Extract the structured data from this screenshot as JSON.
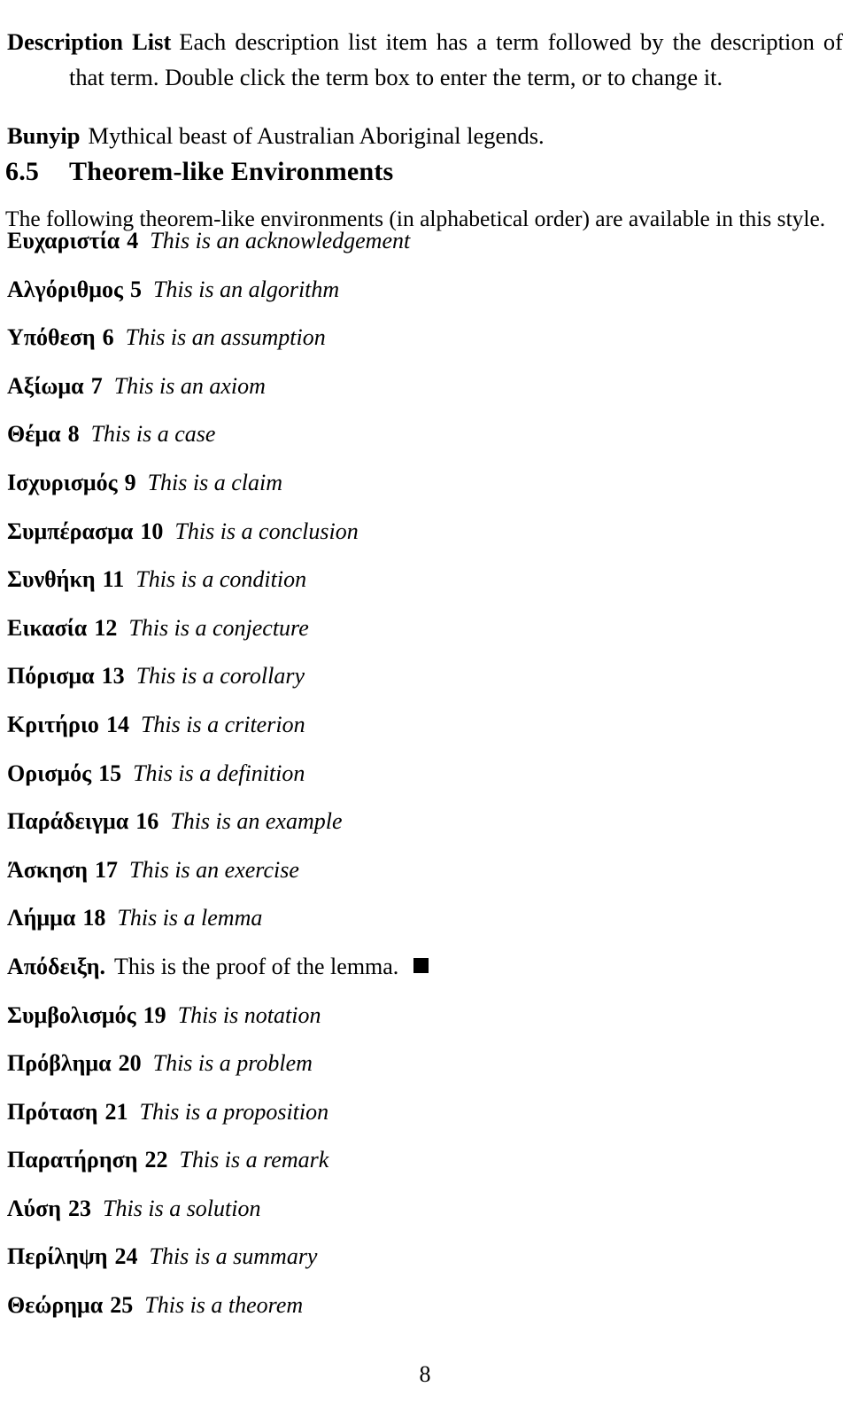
{
  "document": {
    "page_number": "8"
  },
  "description_list": [
    {
      "term": "Description List",
      "body": "Each description list item has a term followed by the description of that term.  Double click the term box to enter the term, or to change it."
    },
    {
      "term": "Bunyip",
      "body": "Mythical beast of Australian Aboriginal legends."
    }
  ],
  "section": {
    "number": "6.5",
    "title": "Theorem-like Environments",
    "intro": "The following theorem-like environments (in alphabetical order) are available in this style."
  },
  "theorems": [
    {
      "head": "Ευχαριστία",
      "num": "4",
      "body": "This is an acknowledgement"
    },
    {
      "head": "Αλγόριθμος",
      "num": "5",
      "body": "This is an algorithm"
    },
    {
      "head": "Υπόθεση",
      "num": "6",
      "body": "This is an assumption"
    },
    {
      "head": "Αξίωμα",
      "num": "7",
      "body": "This is an axiom"
    },
    {
      "head": "Θέμα",
      "num": "8",
      "body": "This is a case"
    },
    {
      "head": "Ισχυρισμός",
      "num": "9",
      "body": "This is a claim"
    },
    {
      "head": "Συμπέρασμα",
      "num": "10",
      "body": "This is a conclusion"
    },
    {
      "head": "Συνθήκη",
      "num": "11",
      "body": "This is a condition"
    },
    {
      "head": "Εικασία",
      "num": "12",
      "body": "This is a conjecture"
    },
    {
      "head": "Πόρισμα",
      "num": "13",
      "body": "This is a corollary"
    },
    {
      "head": "Κριτήριο",
      "num": "14",
      "body": "This is a criterion"
    },
    {
      "head": "Ορισμός",
      "num": "15",
      "body": "This is a definition"
    },
    {
      "head": "Παράδειγμα",
      "num": "16",
      "body": "This is an example"
    },
    {
      "head": "Άσκηση",
      "num": "17",
      "body": "This is an exercise"
    },
    {
      "head": "Λήμμα",
      "num": "18",
      "body": "This is a lemma"
    },
    {
      "head": "Απόδειξη.",
      "num": "",
      "body": "This is the proof of the lemma.",
      "qed": true
    },
    {
      "head": "Συμβολισμός",
      "num": "19",
      "body": "This is notation"
    },
    {
      "head": "Πρόβλημα",
      "num": "20",
      "body": "This is a problem"
    },
    {
      "head": "Πρόταση",
      "num": "21",
      "body": "This is a proposition"
    },
    {
      "head": "Παρατήρηση",
      "num": "22",
      "body": "This is a remark"
    },
    {
      "head": "Λύση",
      "num": "23",
      "body": "This is a solution"
    },
    {
      "head": "Περίληψη",
      "num": "24",
      "body": "This is a summary"
    },
    {
      "head": "Θεώρημα",
      "num": "25",
      "body": "This is a theorem"
    }
  ]
}
